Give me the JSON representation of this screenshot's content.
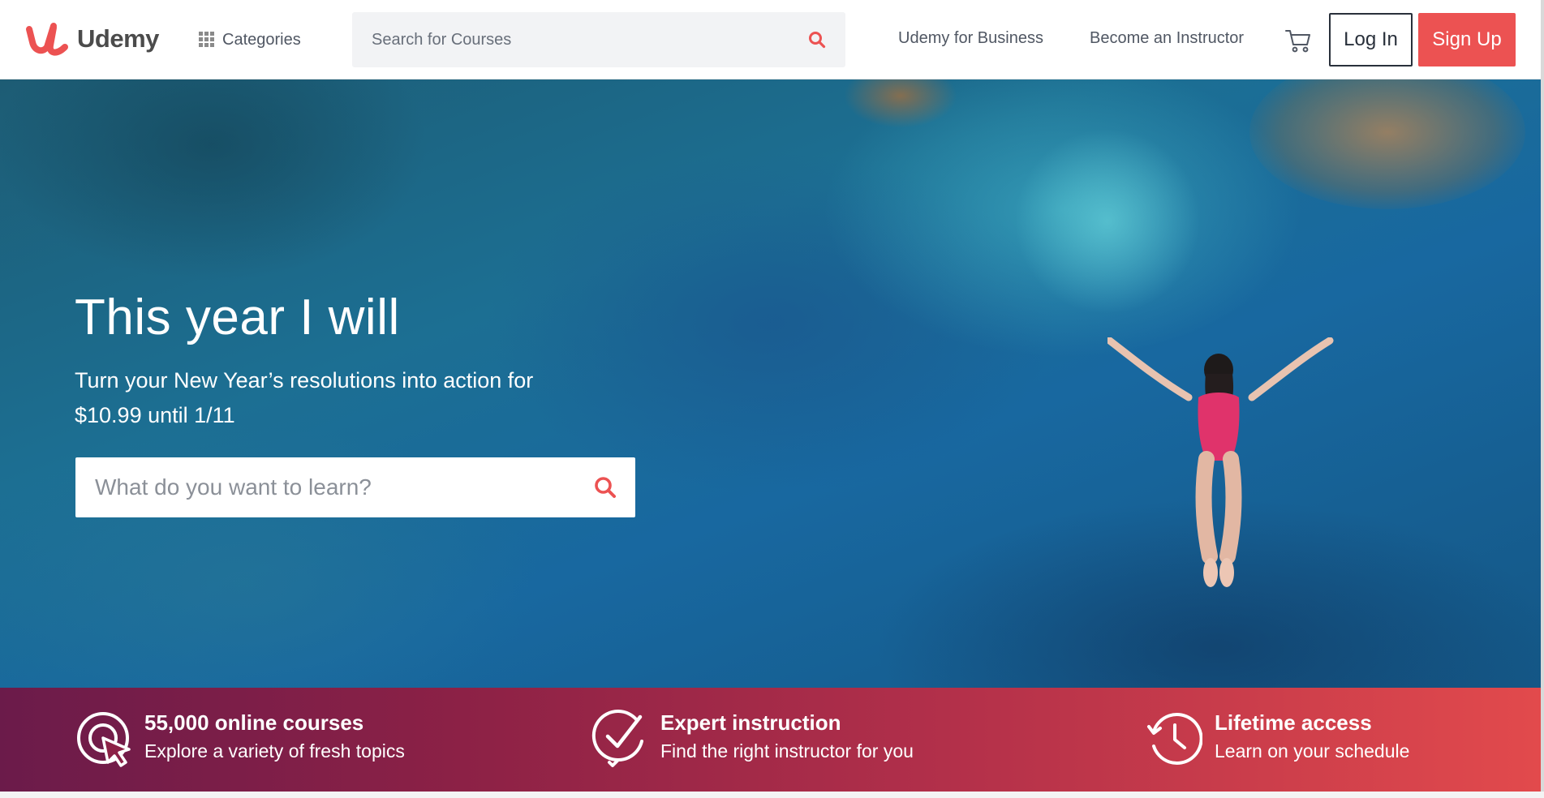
{
  "header": {
    "logo_text": "Udemy",
    "categories_label": "Categories",
    "search_placeholder": "Search for Courses",
    "nav": {
      "business": "Udemy for Business",
      "instructor": "Become an Instructor"
    },
    "login_label": "Log In",
    "signup_label": "Sign Up"
  },
  "hero": {
    "title": "This year I will",
    "subtitle": "Turn your New Year’s resolutions into action for $10.99 until 1/11",
    "search_placeholder": "What do you want to learn?"
  },
  "value_props": [
    {
      "title": "55,000 online courses",
      "description": "Explore a variety of fresh topics",
      "icon": "target-cursor-icon"
    },
    {
      "title": "Expert instruction",
      "description": "Find the right instructor for you",
      "icon": "check-badge-icon"
    },
    {
      "title": "Lifetime access",
      "description": "Learn on your schedule",
      "icon": "history-clock-icon"
    }
  ],
  "icons": {
    "logo": "udemy-logo-icon",
    "categories": "grid-icon",
    "search": "search-icon",
    "cart": "cart-icon"
  },
  "colors": {
    "brand": "#ec5252",
    "text_dark": "#29303b",
    "text_muted": "#505763",
    "band_start": "#6b1b4a",
    "band_end": "#e24a4c"
  }
}
